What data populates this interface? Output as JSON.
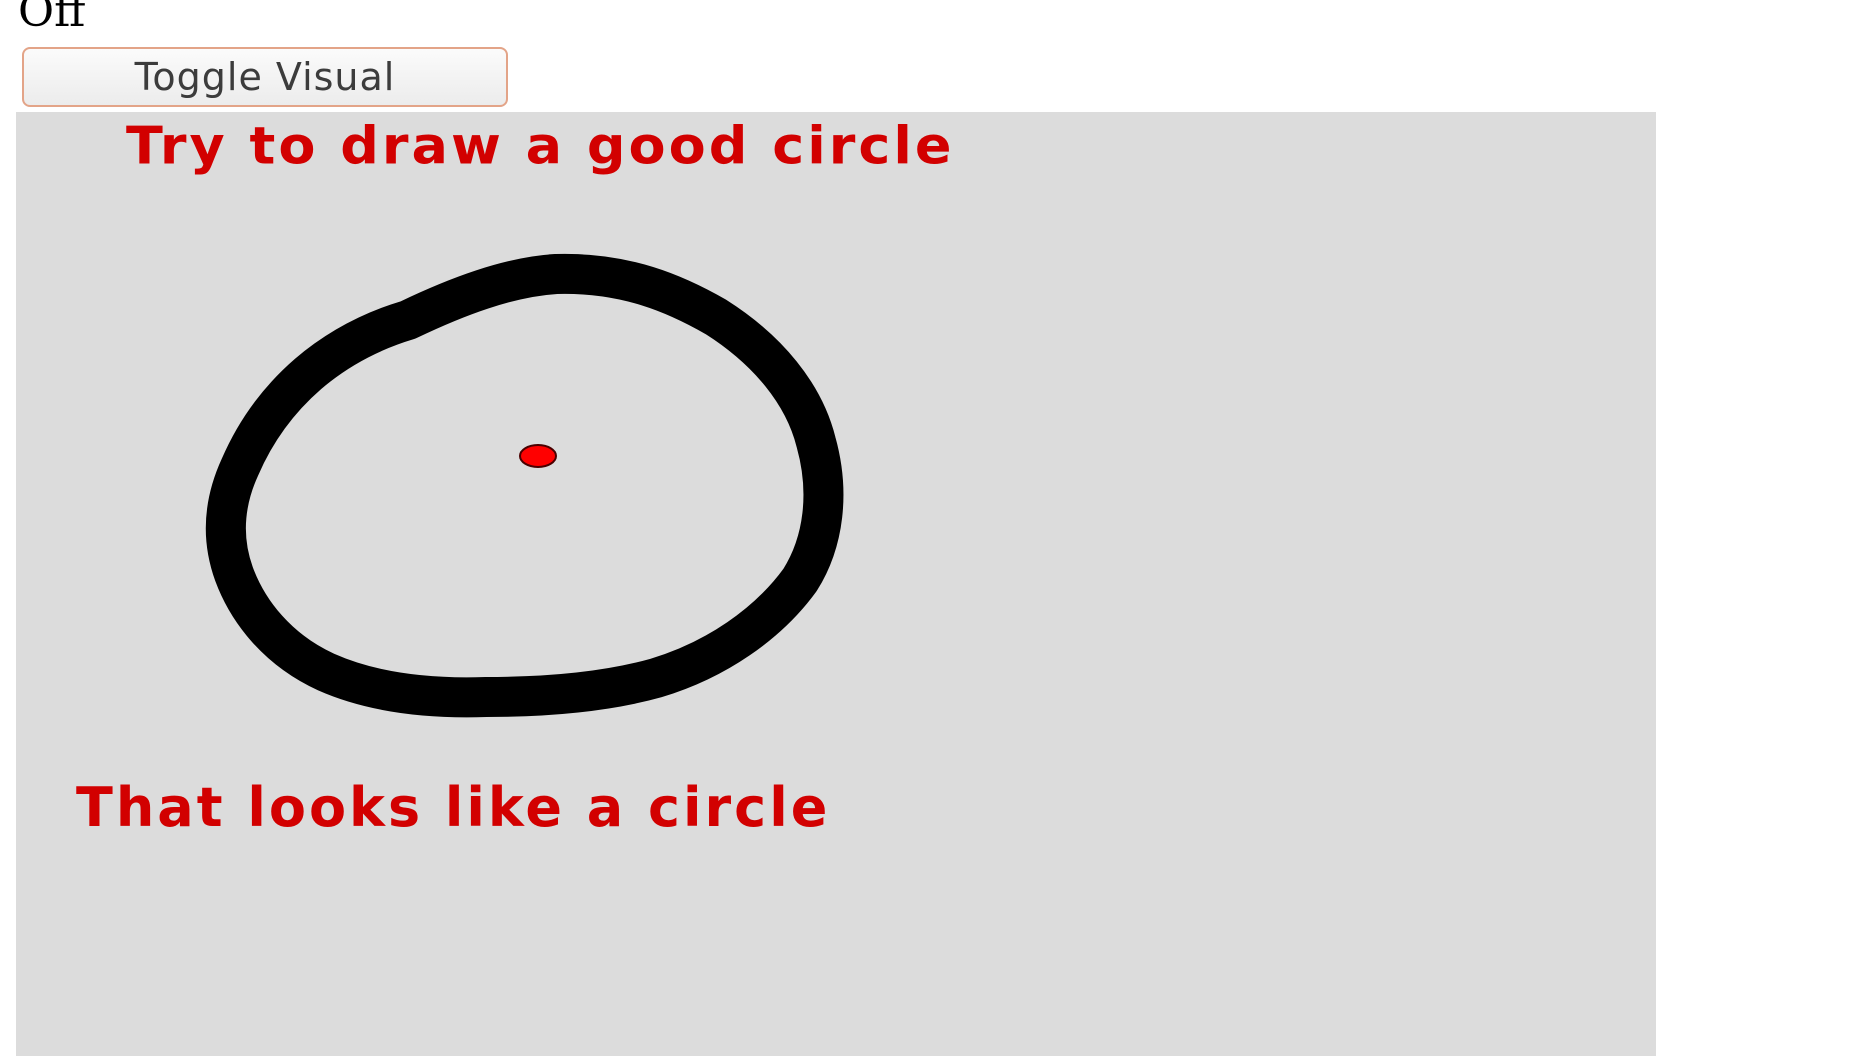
{
  "status": {
    "text": "Off"
  },
  "toolbar": {
    "toggle_label": "Toggle Visual"
  },
  "canvas": {
    "background": "#dcdcdc",
    "prompt": "Try to draw a good circle",
    "result": "That looks like a circle",
    "text_color": "#d20000",
    "stroke_color": "#000000",
    "center_marker_color": "#ff0000"
  }
}
